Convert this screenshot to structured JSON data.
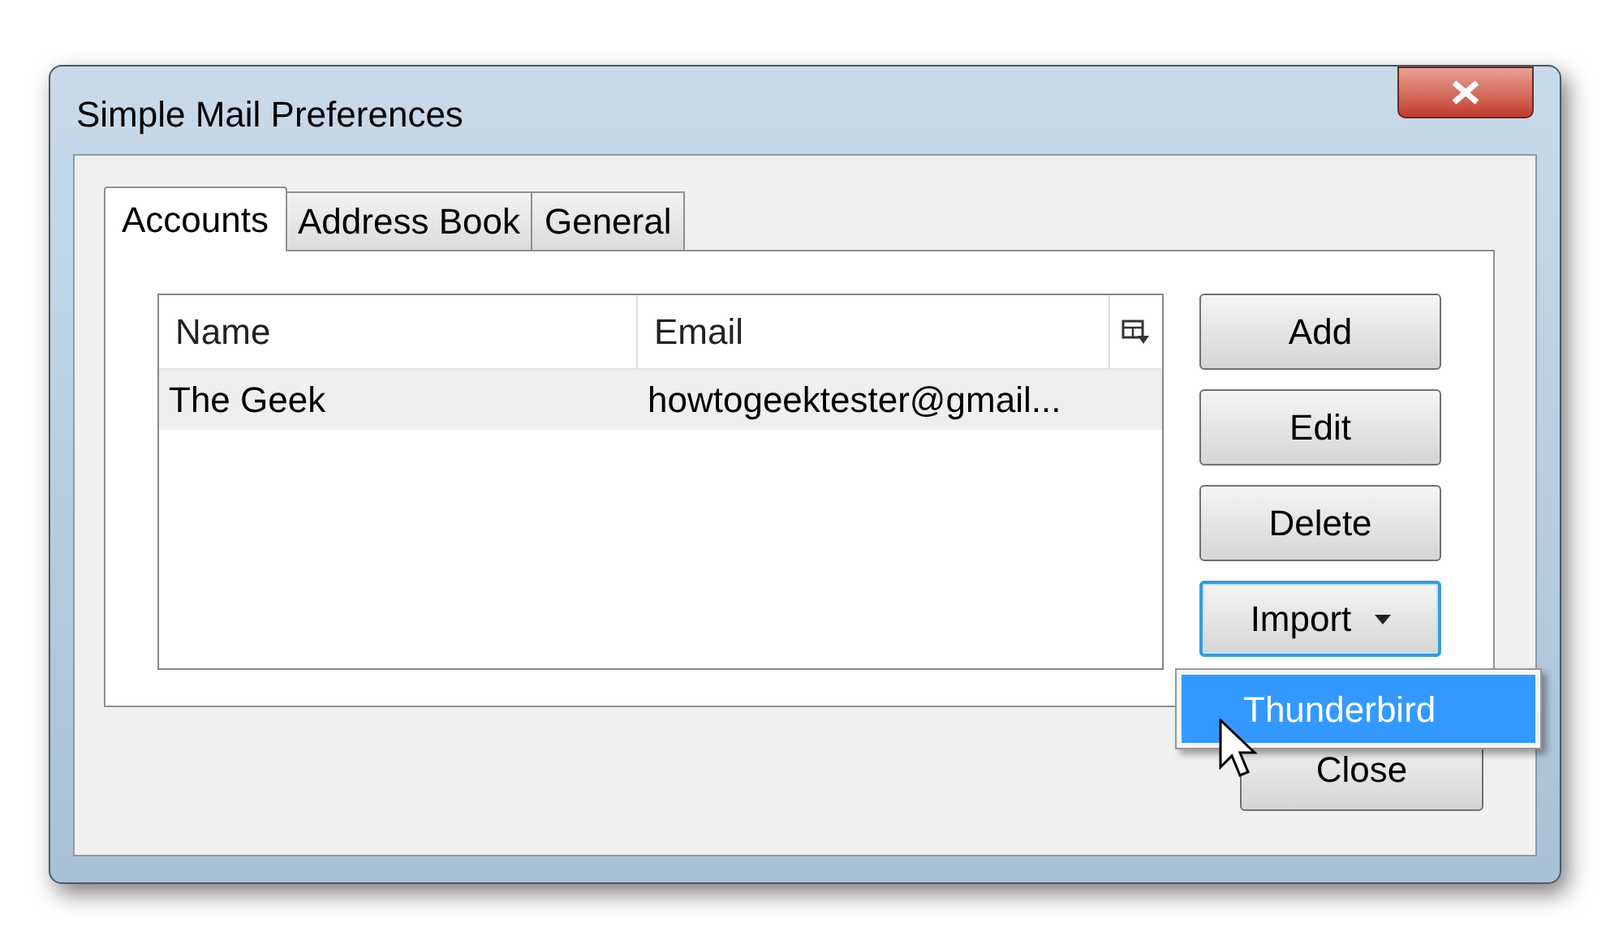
{
  "window": {
    "title": "Simple Mail Preferences"
  },
  "tabs": [
    {
      "label": "Accounts",
      "selected": true
    },
    {
      "label": "Address Book",
      "selected": false
    },
    {
      "label": "General",
      "selected": false
    }
  ],
  "table": {
    "columns": [
      "Name",
      "Email"
    ],
    "rows": [
      {
        "name": "The Geek",
        "email": "howtogeektester@gmail...",
        "selected": true
      }
    ]
  },
  "buttons": [
    {
      "label": "Add",
      "kind": "plain",
      "focused": false
    },
    {
      "label": "Edit",
      "kind": "plain",
      "focused": false
    },
    {
      "label": "Delete",
      "kind": "plain",
      "focused": false
    },
    {
      "label": "Import",
      "kind": "dropdown",
      "focused": true
    }
  ],
  "menu": {
    "items": [
      {
        "label": "Thunderbird",
        "selected": true
      }
    ]
  },
  "close_button": "Close"
}
